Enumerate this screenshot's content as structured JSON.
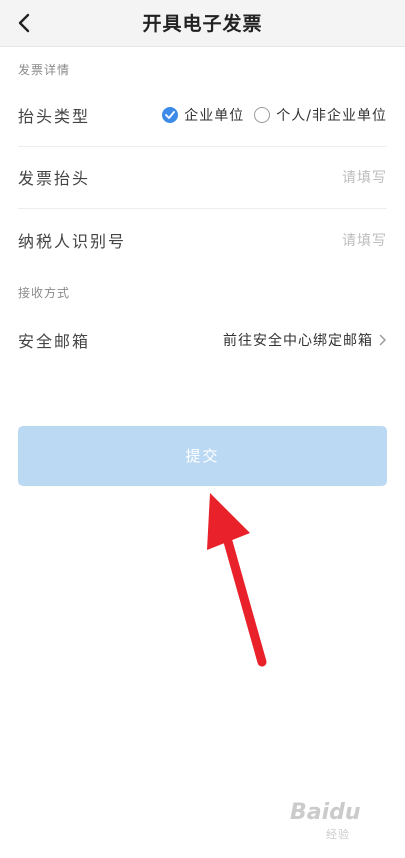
{
  "header": {
    "title": "开具电子发票"
  },
  "sections": {
    "invoice_details": "发票详情",
    "receive_method": "接收方式"
  },
  "form": {
    "title_type": {
      "label": "抬头类型",
      "options": [
        {
          "label": "企业单位",
          "checked": true
        },
        {
          "label": "个人/非企业单位",
          "checked": false
        }
      ]
    },
    "invoice_title": {
      "label": "发票抬头",
      "placeholder": "请填写"
    },
    "taxpayer_id": {
      "label": "纳税人识别号",
      "placeholder": "请填写"
    },
    "email": {
      "label": "安全邮箱",
      "link": "前往安全中心绑定邮箱"
    }
  },
  "submit": {
    "label": "提交"
  },
  "colors": {
    "accent": "#3d8be8",
    "submit_disabled": "#bcd9f3",
    "annotation_arrow": "#e8212a"
  },
  "watermark": {
    "logo": "Baidu",
    "sub": "经验"
  }
}
